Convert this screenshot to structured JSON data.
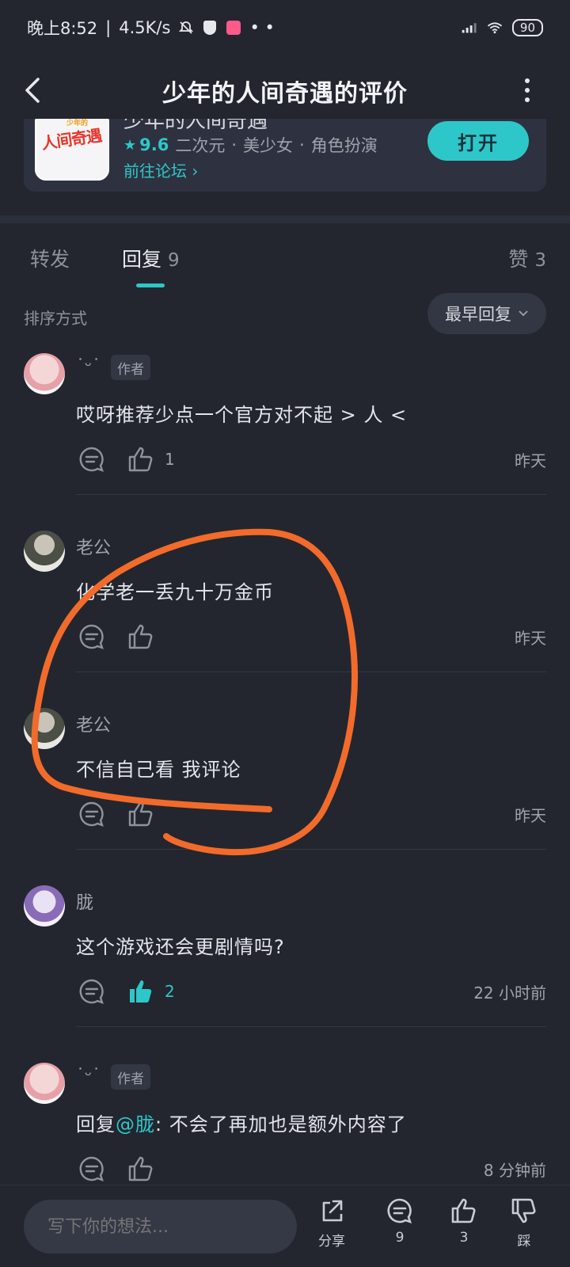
{
  "status_bar": {
    "time": "晚上8:52",
    "network_speed": "4.5K/s",
    "battery": "90"
  },
  "header": {
    "title": "少年的人间奇遇的评价"
  },
  "game_card": {
    "name": "少年的人间奇遇",
    "icon_text": "人间奇遇",
    "icon_small_text": "少年的",
    "rating": "9.6",
    "tags": [
      "二次元",
      "美少女",
      "角色扮演"
    ],
    "separator": "·",
    "forum_link": "前往论坛",
    "open_button": "打开"
  },
  "tabs": {
    "forward": "转发",
    "reply": "回复",
    "reply_count": "9",
    "like": "赞",
    "like_count": "3"
  },
  "sort": {
    "label": "排序方式",
    "option": "最早回复"
  },
  "replies": [
    {
      "username": "˙ᵕ˙",
      "badge": "作者",
      "content": "哎呀推荐少点一个官方对不起 > 人 <",
      "likes": "1",
      "time": "昨天"
    },
    {
      "username": "老公",
      "badge": "",
      "content": "化学老一丢九十万金币",
      "likes": "",
      "time": "昨天"
    },
    {
      "username": "老公",
      "badge": "",
      "content": "不信自己看 我评论",
      "likes": "",
      "time": "昨天"
    },
    {
      "username": "胧",
      "badge": "",
      "content": "这个游戏还会更剧情吗?",
      "likes": "2",
      "time": "22 小时前",
      "liked": true
    },
    {
      "username": "˙ᵕ˙",
      "badge": "作者",
      "content_prefix": "回复",
      "mention": "@胧",
      "content": ": 不会了再加也是额外内容了",
      "likes": "",
      "time": "8 分钟前"
    }
  ],
  "bottom_bar": {
    "input_placeholder": "写下你的想法...",
    "share": "分享",
    "comments": "9",
    "likes": "3",
    "dislike": "踩"
  },
  "colors": {
    "accent": "#2ec7c9",
    "background": "#23262f",
    "annotation": "#f26b2a"
  }
}
